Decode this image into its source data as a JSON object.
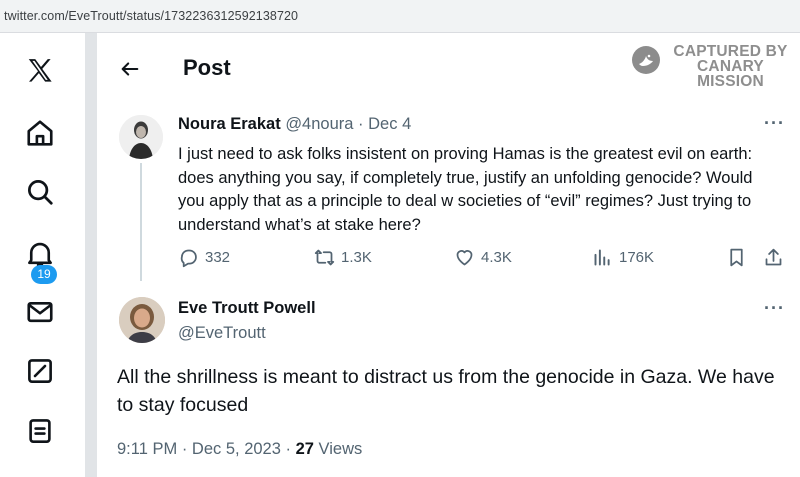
{
  "browser": {
    "url": "twitter.com/EveTroutt/status/1732236312592138720"
  },
  "nav": {
    "items": [
      "x-logo",
      "home",
      "explore",
      "notifications",
      "messages",
      "compose",
      "lists"
    ],
    "notification_count": "19"
  },
  "header": {
    "title": "Post"
  },
  "watermark": {
    "line1": "CAPTURED BY",
    "line2": "CANARY MISSION"
  },
  "quoted_post": {
    "author_name": "Noura Erakat",
    "handle": "@4noura",
    "separator": "·",
    "date": "Dec 4",
    "text": "I just need to ask folks insistent on proving Hamas is the greatest evil on earth: does anything you say, if completely true, justify an unfolding genocide? Would you apply that as a principle to deal w societies of “evil” regimes?  Just trying to understand what’s at stake here?",
    "replies": "332",
    "reposts": "1.3K",
    "likes": "4.3K",
    "views": "176K"
  },
  "main_post": {
    "author_name": "Eve Troutt Powell",
    "handle": "@EveTroutt",
    "text": "All the shrillness is meant to distract us from the genocide in Gaza.  We have to stay focused",
    "time": "9:11 PM",
    "date": "Dec 5, 2023",
    "separator": "·",
    "views_count": "27",
    "views_label": "Views"
  },
  "colors": {
    "accent": "#1d9bf0",
    "text": "#0f1419",
    "muted": "#536471",
    "divider": "#e1e4e7"
  }
}
